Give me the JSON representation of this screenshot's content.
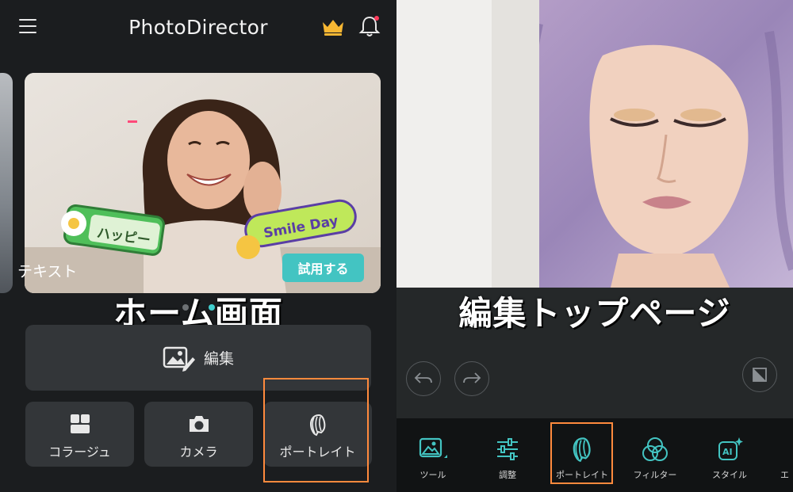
{
  "left_screen": {
    "header": {
      "title": "PhotoDirector",
      "icons": [
        "menu-icon",
        "crown-icon",
        "bell-icon"
      ],
      "crown_color": "#f7b733",
      "notification_dot_color": "#ff3b5c"
    },
    "hero": {
      "caption": "テキスト",
      "try_button": "試用する",
      "sticker_1": "ハッピー",
      "sticker_2": "Smile Day"
    },
    "overlay_label": "ホーム画面",
    "carousel": {
      "count": 3,
      "active": 1
    },
    "edit_button": {
      "label": "編集",
      "icon": "photo-edit-icon"
    },
    "tiles": [
      {
        "label": "コラージュ",
        "icon": "collage-icon"
      },
      {
        "label": "カメラ",
        "icon": "camera-icon"
      },
      {
        "label": "ポートレイト",
        "icon": "portrait-icon",
        "highlighted": true
      }
    ]
  },
  "right_screen": {
    "overlay_label": "編集トップページ",
    "controls": [
      "undo-icon",
      "redo-icon",
      "compare-icon"
    ],
    "toolbar": [
      {
        "label": "ツール",
        "icon": "tools-icon"
      },
      {
        "label": "調整",
        "icon": "sliders-icon"
      },
      {
        "label": "ポートレイト",
        "icon": "portrait-icon",
        "highlighted": true
      },
      {
        "label": "フィルター",
        "icon": "filter-icon"
      },
      {
        "label": "スタイル",
        "icon": "ai-style-icon"
      },
      {
        "label": "エ",
        "icon": "effect-icon"
      }
    ],
    "accent_color": "#43c4c2",
    "highlight_color": "#ff8a3d"
  }
}
